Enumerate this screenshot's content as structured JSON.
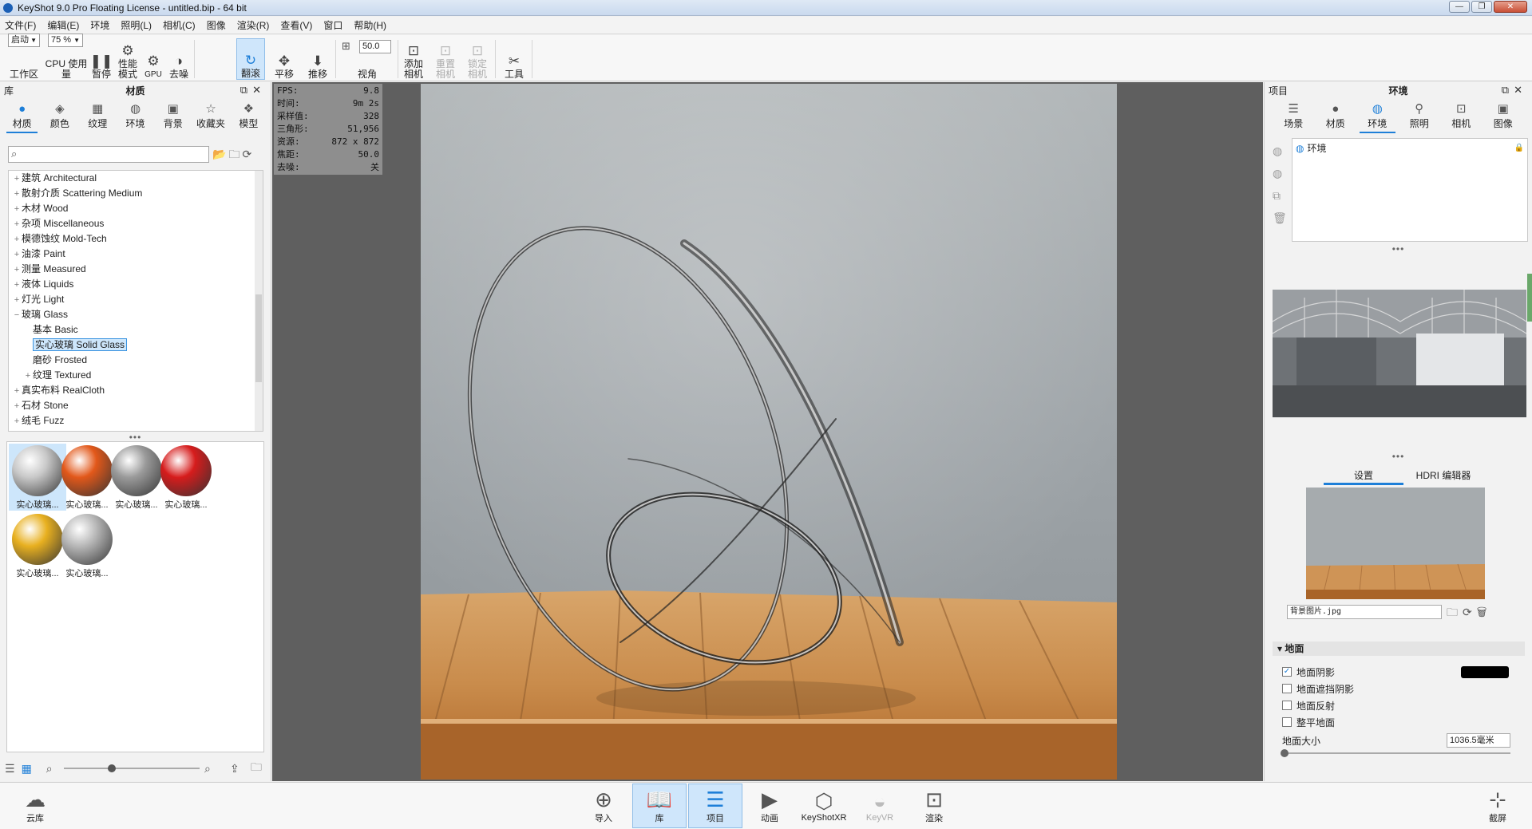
{
  "window": {
    "title": "KeyShot 9.0 Pro Floating License  - untitled.bip  - 64 bit",
    "minimize": "—",
    "maximize": "❐",
    "close": "✕"
  },
  "menu": [
    "文件(F)",
    "编辑(E)",
    "环境",
    "照明(L)",
    "相机(C)",
    "图像",
    "渲染(R)",
    "查看(V)",
    "窗口",
    "帮助(H)"
  ],
  "toolbar": {
    "workspace_value": "启动",
    "workspace_label": "工作区",
    "cpu_value": "75 %",
    "cpu_label": "CPU 使用量",
    "pause": "暂停",
    "perf": "性能\n模式",
    "gpu": "GPU",
    "denoise": "去噪",
    "tumble": "翻滚",
    "pan": "平移",
    "dolly": "推移",
    "fov_value": "50.0",
    "fov_label": "视角",
    "add_cam": "添加\n相机",
    "reset_cam": "重置\n相机",
    "lock_cam": "锁定\n相机",
    "tools": "工具"
  },
  "left_panel": {
    "lib_label": "库",
    "title": "材质",
    "tabs": [
      {
        "label": "材质",
        "icon": "material-icon"
      },
      {
        "label": "颜色",
        "icon": "color-icon"
      },
      {
        "label": "纹理",
        "icon": "texture-icon"
      },
      {
        "label": "环境",
        "icon": "environment-icon"
      },
      {
        "label": "背景",
        "icon": "background-icon"
      },
      {
        "label": "收藏夹",
        "icon": "favorites-icon"
      },
      {
        "label": "模型",
        "icon": "model-icon"
      }
    ],
    "tree": [
      {
        "pm": "+",
        "label": "建筑 Architectural",
        "indent": 0
      },
      {
        "pm": "+",
        "label": "散射介质 Scattering Medium",
        "indent": 0
      },
      {
        "pm": "+",
        "label": "木材 Wood",
        "indent": 0
      },
      {
        "pm": "+",
        "label": "杂项 Miscellaneous",
        "indent": 0
      },
      {
        "pm": "+",
        "label": "模德蚀纹 Mold-Tech",
        "indent": 0
      },
      {
        "pm": "+",
        "label": "油漆 Paint",
        "indent": 0
      },
      {
        "pm": "+",
        "label": "测量 Measured",
        "indent": 0
      },
      {
        "pm": "+",
        "label": "液体 Liquids",
        "indent": 0
      },
      {
        "pm": "+",
        "label": "灯光 Light",
        "indent": 0
      },
      {
        "pm": "−",
        "label": "玻璃 Glass",
        "indent": 0
      },
      {
        "pm": "",
        "label": "基本 Basic",
        "indent": 1
      },
      {
        "pm": "",
        "label": "实心玻璃 Solid Glass",
        "indent": 1,
        "selected": true
      },
      {
        "pm": "",
        "label": "磨砂 Frosted",
        "indent": 1
      },
      {
        "pm": "+",
        "label": "纹理 Textured",
        "indent": 1
      },
      {
        "pm": "+",
        "label": "真实布料 RealCloth",
        "indent": 0
      },
      {
        "pm": "+",
        "label": "石材 Stone",
        "indent": 0
      },
      {
        "pm": "+",
        "label": "绒毛 Fuzz",
        "indent": 0
      }
    ],
    "thumbs": [
      {
        "label": "实心玻璃...",
        "color": "#c8c8c8",
        "selected": true
      },
      {
        "label": "实心玻璃...",
        "color": "#e2581a"
      },
      {
        "label": "实心玻璃...",
        "color": "#9a9a9a"
      },
      {
        "label": "实心玻璃...",
        "color": "#d61c1c"
      },
      {
        "label": "实心玻璃...",
        "color": "#e8b020"
      },
      {
        "label": "实心玻璃...",
        "color": "#b8b8b8"
      }
    ]
  },
  "stats": [
    {
      "k": "FPS:",
      "v": "9.8"
    },
    {
      "k": "时间:",
      "v": "9m 2s"
    },
    {
      "k": "采样值:",
      "v": "328"
    },
    {
      "k": "三角形:",
      "v": "51,956"
    },
    {
      "k": "资源:",
      "v": "872 x 872"
    },
    {
      "k": "焦距:",
      "v": "50.0"
    },
    {
      "k": "去噪:",
      "v": "关"
    }
  ],
  "right_panel": {
    "project_label": "项目",
    "title": "环境",
    "tabs": [
      {
        "label": "场景",
        "icon": "scene-icon"
      },
      {
        "label": "材质",
        "icon": "material-icon"
      },
      {
        "label": "环境",
        "icon": "environment-icon"
      },
      {
        "label": "照明",
        "icon": "lighting-icon"
      },
      {
        "label": "相机",
        "icon": "camera-icon"
      },
      {
        "label": "图像",
        "icon": "image-icon"
      }
    ],
    "env_item": "环境",
    "subtab_settings": "设置",
    "subtab_hdri": "HDRI 编辑器",
    "bg_file": "背景图片.jpg",
    "ground_section": "地面",
    "ground_shadow": "地面阴影",
    "ground_occlusion": "地面遮挡阴影",
    "ground_reflection": "地面反射",
    "flatten_ground": "整平地面",
    "ground_size_label": "地面大小",
    "ground_size_value": "1036.5毫米",
    "shadow_color": "#000000"
  },
  "bottom": {
    "cloud": "云库",
    "import": "导入",
    "library": "库",
    "project": "项目",
    "animation": "动画",
    "keyshotxr": "KeyShotXR",
    "keyvr": "KeyVR",
    "render": "渲染",
    "screenshot": "截屏"
  }
}
